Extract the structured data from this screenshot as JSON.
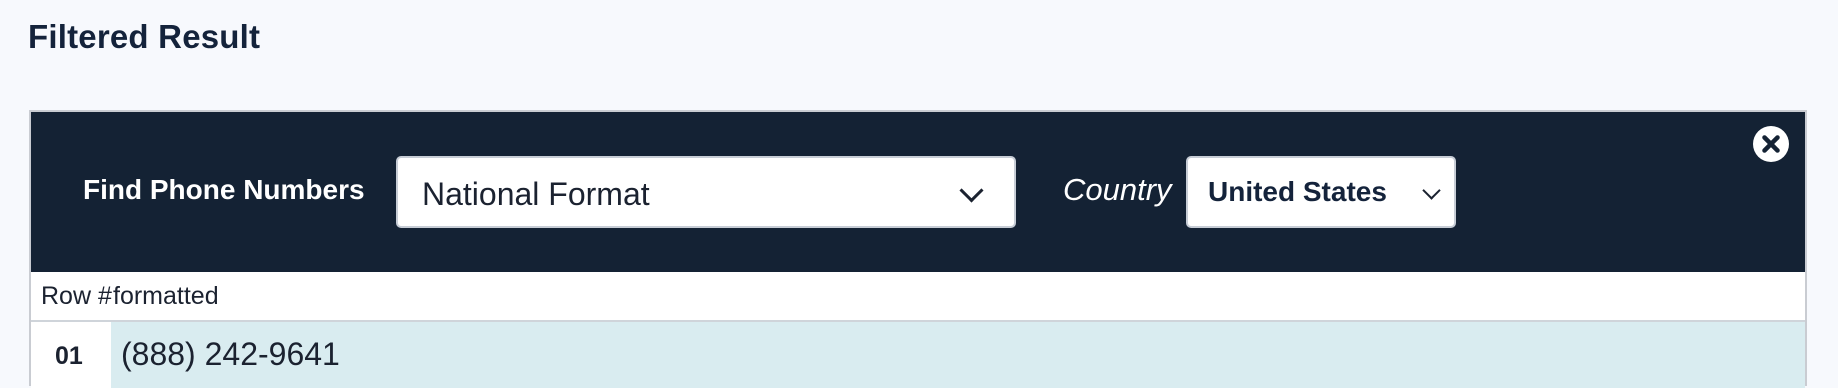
{
  "page": {
    "title": "Filtered Result"
  },
  "toolbar": {
    "find_label": "Find Phone Numbers",
    "format_select": {
      "value": "National Format",
      "icon": "chevron-down-icon"
    },
    "country_label": "Country",
    "country_select": {
      "value": "United States",
      "icon": "chevron-down-icon"
    },
    "close_icon": "close-circle-icon"
  },
  "table": {
    "headers": {
      "row": "Row #",
      "formatted": "formatted"
    },
    "rows": [
      {
        "row_num": "01",
        "formatted": "(888) 242-9641"
      }
    ]
  },
  "colors": {
    "toolbar_bg": "#142234",
    "row_highlight": "#d9ecf0",
    "page_bg": "#f7f9fd"
  }
}
